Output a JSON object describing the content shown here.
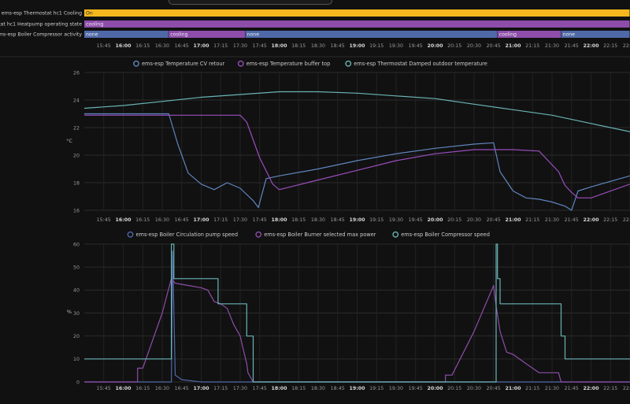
{
  "timeline": {
    "x_range": [
      "15:30",
      "22:30"
    ],
    "ticks": [
      "15:45",
      "16:00",
      "16:15",
      "16:30",
      "16:45",
      "17:00",
      "17:15",
      "17:30",
      "17:45",
      "18:00",
      "18:15",
      "18:30",
      "18:45",
      "19:00",
      "19:15",
      "19:30",
      "19:45",
      "20:00",
      "20:15",
      "20:30",
      "20:45",
      "21:00",
      "21:15",
      "21:30",
      "21:45",
      "22:00",
      "22:15",
      "22:30"
    ],
    "bold_ticks": [
      "16:00",
      "17:00",
      "18:00",
      "19:00",
      "20:00",
      "21:00",
      "22:00"
    ],
    "rows": [
      {
        "label": "ems-esp Thermostat hc1 Cooling",
        "segments": [
          {
            "start": "15:30",
            "end": "22:30",
            "value": "On",
            "color": "#f4b81e"
          }
        ]
      },
      {
        "label": "thermostat hc1 Heatpump operating state",
        "segments": [
          {
            "start": "15:30",
            "end": "22:30",
            "value": "cooling",
            "color": "#8e4dab"
          }
        ]
      },
      {
        "label": "ems-esp Boiler Compressor activity",
        "segments": [
          {
            "start": "15:30",
            "end": "16:35",
            "value": "none",
            "color": "#4f69a8"
          },
          {
            "start": "16:35",
            "end": "17:34",
            "value": "cooling",
            "color": "#8e4dab"
          },
          {
            "start": "17:34",
            "end": "20:48",
            "value": "none",
            "color": "#4f69a8"
          },
          {
            "start": "20:48",
            "end": "21:37",
            "value": "cooling",
            "color": "#8e4dab"
          },
          {
            "start": "21:37",
            "end": "22:30",
            "value": "none",
            "color": "#4f69a8"
          }
        ]
      }
    ]
  },
  "chart_data": [
    {
      "type": "line",
      "x_range": [
        "15:30",
        "22:30"
      ],
      "ylim": [
        16,
        26
      ],
      "y_ticks": [
        16,
        18,
        20,
        22,
        24,
        26
      ],
      "ylabel": "°C",
      "grid": true,
      "legend_position": "top-center",
      "series": [
        {
          "name": "ems-esp Temperature CV retour",
          "color": "#5f86bf",
          "x": [
            "15:30",
            "16:35",
            "16:42",
            "16:50",
            "17:00",
            "17:10",
            "17:20",
            "17:30",
            "17:40",
            "17:44",
            "17:50",
            "18:00",
            "18:30",
            "19:00",
            "19:30",
            "20:00",
            "20:30",
            "20:45",
            "20:50",
            "21:00",
            "21:10",
            "21:20",
            "21:30",
            "21:40",
            "21:45",
            "21:50",
            "22:00",
            "22:30"
          ],
          "y": [
            23.0,
            23.0,
            20.8,
            18.7,
            17.9,
            17.5,
            18.0,
            17.6,
            16.7,
            16.2,
            18.3,
            18.5,
            19.0,
            19.6,
            20.1,
            20.5,
            20.8,
            20.9,
            18.8,
            17.4,
            16.9,
            16.8,
            16.6,
            16.3,
            16.0,
            17.4,
            17.7,
            18.5
          ]
        },
        {
          "name": "ems-esp Temperature buffer top",
          "color": "#9a4dbd",
          "x": [
            "15:30",
            "17:30",
            "17:35",
            "17:45",
            "17:55",
            "18:00",
            "18:30",
            "19:00",
            "19:30",
            "20:00",
            "20:30",
            "21:00",
            "21:20",
            "21:35",
            "21:40",
            "21:45",
            "21:50",
            "22:00",
            "22:30"
          ],
          "y": [
            22.9,
            22.9,
            22.4,
            19.8,
            17.9,
            17.5,
            18.2,
            18.9,
            19.6,
            20.1,
            20.4,
            20.4,
            20.3,
            18.8,
            17.8,
            17.3,
            16.9,
            16.9,
            17.9
          ]
        },
        {
          "name": "ems-esp Thermostat Damped outdoor temperature",
          "color": "#6ab3b5",
          "x": [
            "15:30",
            "16:00",
            "16:30",
            "17:00",
            "17:30",
            "18:00",
            "18:30",
            "19:00",
            "19:30",
            "20:00",
            "20:30",
            "21:00",
            "21:30",
            "22:00",
            "22:30"
          ],
          "y": [
            23.4,
            23.6,
            23.9,
            24.2,
            24.4,
            24.6,
            24.6,
            24.5,
            24.3,
            24.1,
            23.7,
            23.3,
            22.9,
            22.3,
            21.7
          ]
        }
      ]
    },
    {
      "type": "line",
      "x_range": [
        "15:30",
        "22:30"
      ],
      "ylim": [
        0,
        60
      ],
      "y_ticks": [
        0,
        10,
        20,
        30,
        40,
        50,
        60
      ],
      "ylabel": "%",
      "grid": true,
      "legend_position": "top-center",
      "series": [
        {
          "name": "ems-esp Boiler Circulation pump speed",
          "color": "#4f69a8",
          "x": [
            "15:30",
            "16:37",
            "16:38",
            "16:40",
            "16:45",
            "17:00",
            "21:00",
            "22:30"
          ],
          "y": [
            0,
            0,
            57,
            3,
            1,
            0,
            0,
            0
          ]
        },
        {
          "name": "ems-esp Boiler Burner selected max power",
          "color": "#8e4dab",
          "x": [
            "15:30",
            "16:11",
            "16:11",
            "16:15",
            "16:30",
            "16:37",
            "16:40",
            "16:50",
            "17:00",
            "17:05",
            "17:10",
            "17:15",
            "17:20",
            "17:25",
            "17:30",
            "17:32",
            "17:35",
            "17:36",
            "17:40",
            "20:08",
            "20:08",
            "20:13",
            "20:30",
            "20:45",
            "20:47",
            "20:50",
            "20:55",
            "21:00",
            "21:10",
            "21:15",
            "21:20",
            "21:30",
            "21:35",
            "21:37",
            "21:40",
            "22:30"
          ],
          "y": [
            0,
            0,
            6,
            6,
            30,
            45,
            43,
            42,
            41,
            40,
            35,
            34,
            32,
            25,
            20,
            15,
            8,
            4,
            0,
            0,
            3,
            3,
            22,
            42,
            33,
            22,
            13,
            12,
            8,
            6,
            4,
            4,
            4,
            0,
            0,
            0
          ]
        },
        {
          "name": "ems-esp Boiler Compressor speed",
          "color": "#6ab3b5",
          "x": [
            "15:30",
            "16:37",
            "16:37",
            "16:39",
            "16:39",
            "16:40",
            "16:40",
            "17:13",
            "17:13",
            "17:35",
            "17:35",
            "17:40",
            "17:40",
            "20:47",
            "20:47",
            "20:48",
            "20:48",
            "20:50",
            "20:50",
            "21:37",
            "21:37",
            "21:40",
            "21:40",
            "22:30"
          ],
          "y": [
            10,
            10,
            60,
            60,
            45,
            45,
            45,
            45,
            34,
            34,
            20,
            20,
            0,
            0,
            60,
            60,
            45,
            45,
            34,
            34,
            20,
            20,
            10,
            10
          ]
        }
      ]
    }
  ]
}
